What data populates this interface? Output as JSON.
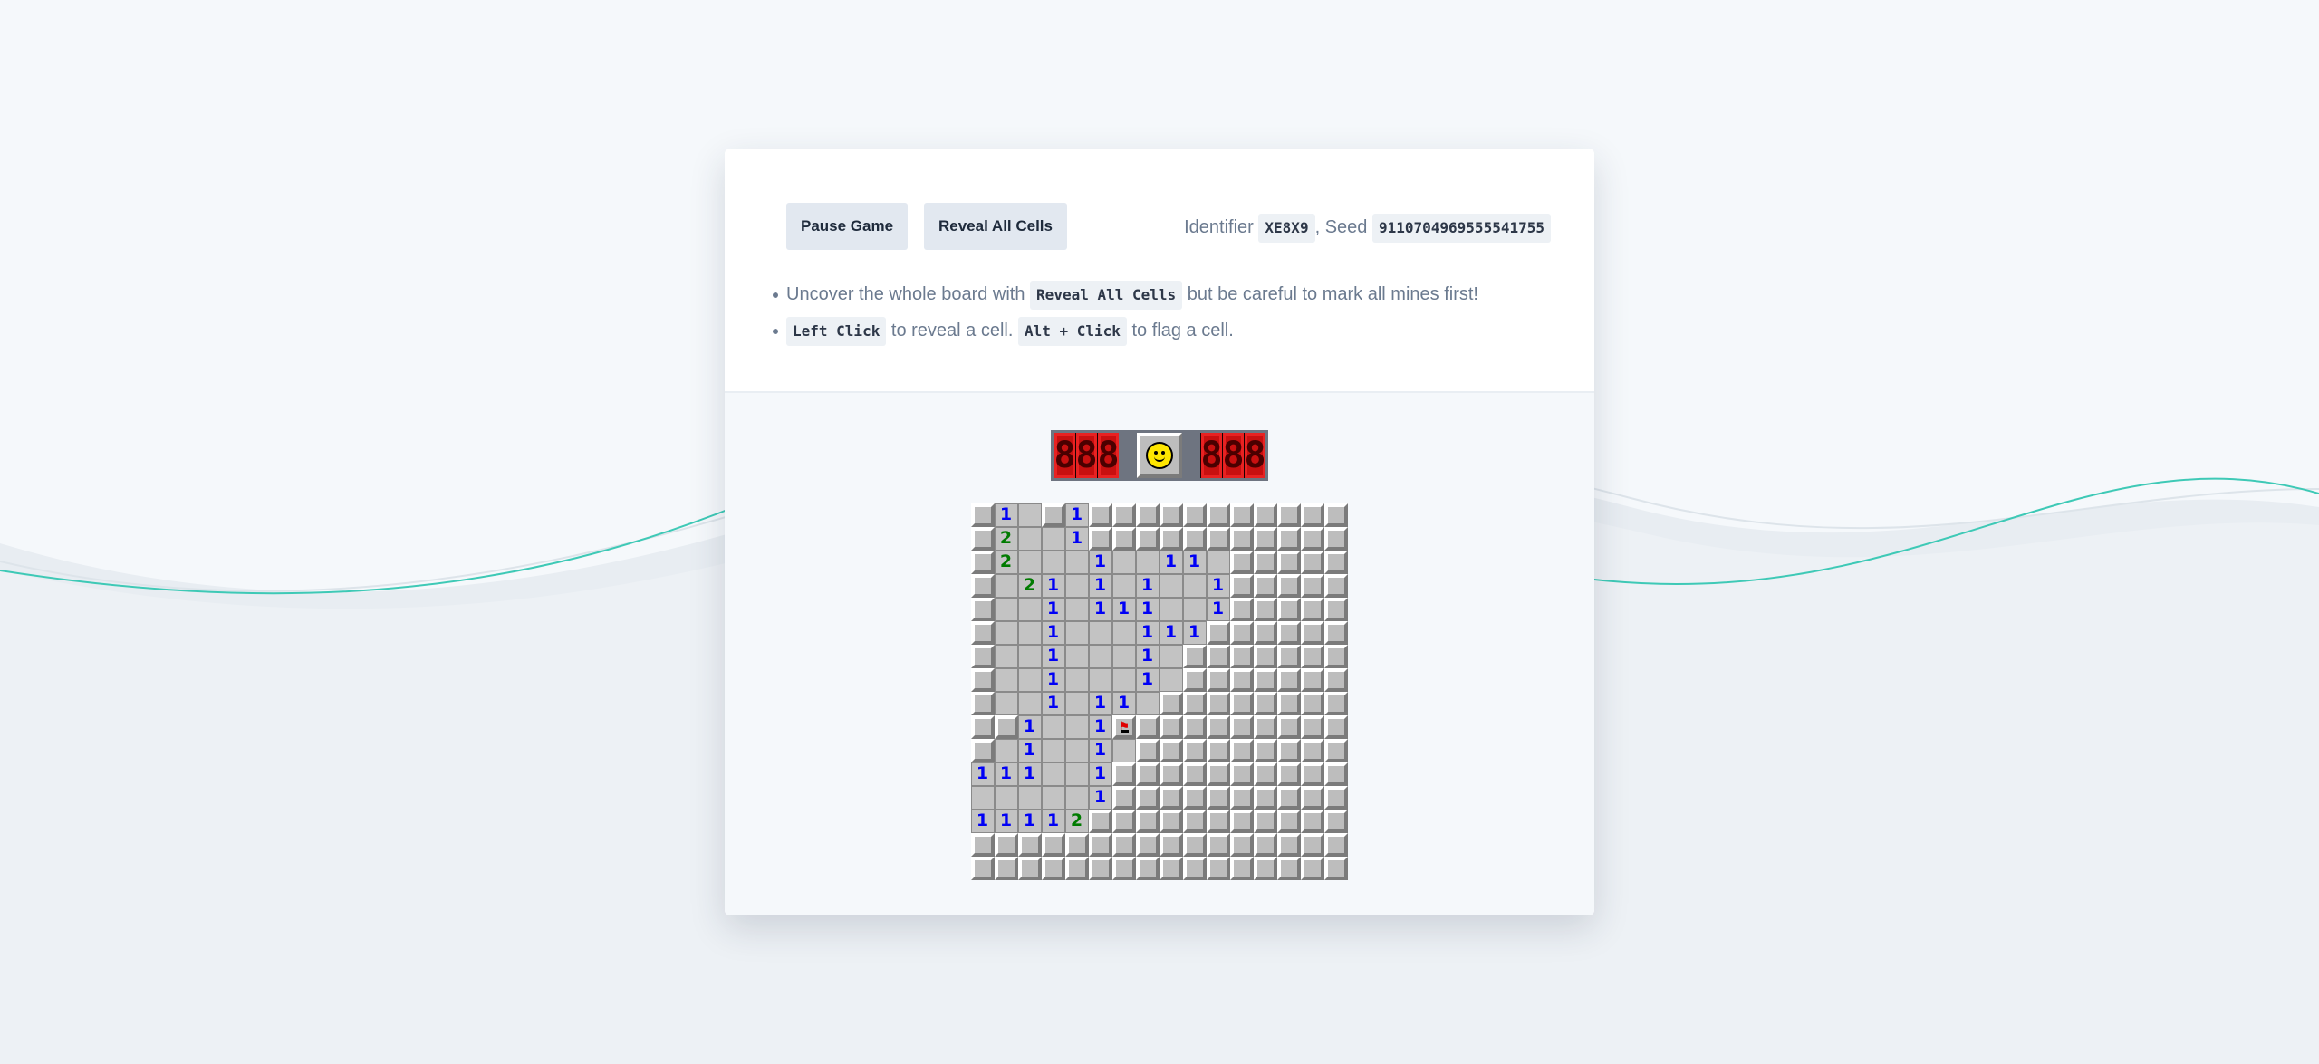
{
  "buttons": {
    "pause_label": "Pause Game",
    "reveal_label": "Reveal All Cells"
  },
  "meta": {
    "identifier_label": "Identifier",
    "identifier_value": "XE8X9",
    "seed_label": ", Seed",
    "seed_value": "9110704969555541755"
  },
  "help": {
    "line1_prefix": "Uncover the whole board with",
    "line1_code": "Reveal All Cells",
    "line1_suffix": "but be careful to mark all mines first!",
    "line2_code1": "Left Click",
    "line2_mid": "to reveal a cell.",
    "line2_code2": "Alt + Click",
    "line2_suffix": "to flag a cell."
  },
  "scoreboard": {
    "mines_display": [
      "8",
      "8",
      "8"
    ],
    "timer_display": [
      "8",
      "8",
      "8"
    ],
    "face": "smiley-icon"
  },
  "board": {
    "cols": 16,
    "legend": "H = hidden, 0 = open empty, 1-8 = open number, F = flag",
    "rows": [
      "H10H1HHHHHHHHHHH",
      "H2001HHHHHHHHHHH",
      "H2000100110HHHHH",
      "H0210101001HHHHH",
      "H0010111001HHHHH",
      "H001000111HHHHHH",
      "H00100010HHHHHHH",
      "H00100010HHHHHHH",
      "H0010110HHHHHHHH",
      "HH1001FHHHHHHHHH",
      "H010010HHHHHHHHH",
      "111001HHHHHHHHHH",
      "000001HHHHHHHHHH",
      "11112HHHHHHHHHHH",
      "HHHHHHHHHHHHHHHH",
      "HHHHHHHHHHHHHHHH"
    ]
  },
  "colors": {
    "one": "#0000f5",
    "two": "#007b00",
    "flag": "#e00000",
    "teal_wave": "#3ec9b6"
  }
}
